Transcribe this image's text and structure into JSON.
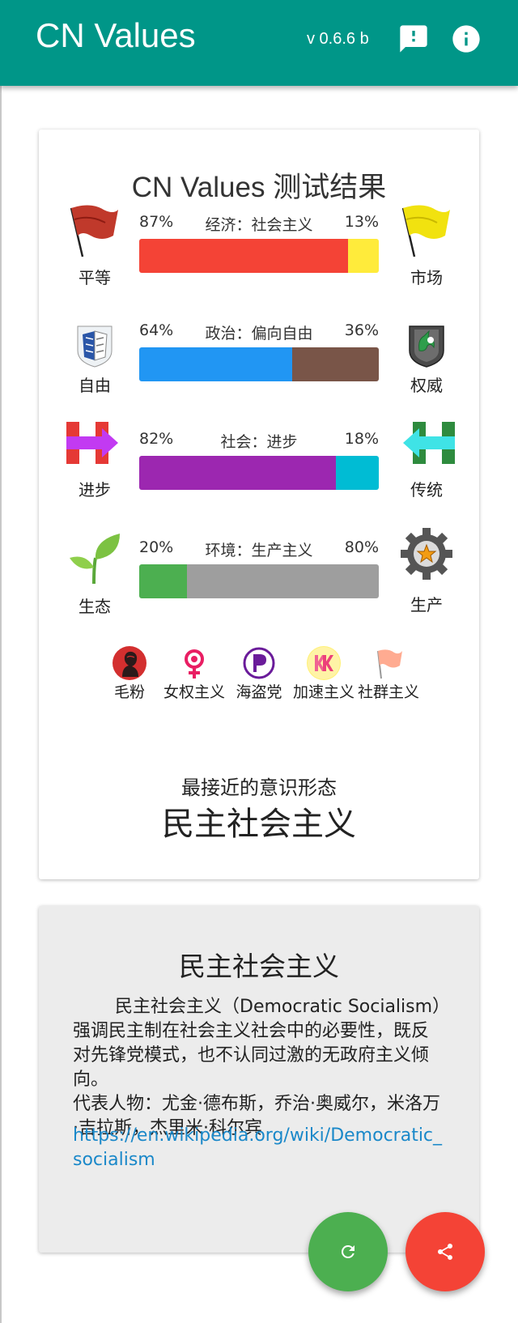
{
  "appbar": {
    "title": "CN Values",
    "version": "v 0.6.6 b",
    "icons": [
      "feedback-icon",
      "info-icon"
    ]
  },
  "result": {
    "title": "CN Values 测试结果",
    "axes": [
      {
        "left_label": "平等",
        "right_label": "市场",
        "left_pct": "87%",
        "right_pct": "13%",
        "name": "经济：社会主义",
        "left_value": 87,
        "left_color": "#f44336",
        "right_color": "#ffeb3b",
        "left_icon": "red-flag-icon",
        "right_icon": "yellow-flag-icon"
      },
      {
        "left_label": "自由",
        "right_label": "权威",
        "left_pct": "64%",
        "right_pct": "36%",
        "name": "政治：偏向自由",
        "left_value": 64,
        "left_color": "#2196f3",
        "right_color": "#795548",
        "left_icon": "wings-emblem-icon",
        "right_icon": "unicorn-shield-icon"
      },
      {
        "left_label": "进步",
        "right_label": "传统",
        "left_pct": "82%",
        "right_pct": "18%",
        "name": "社会：进步",
        "left_value": 82,
        "left_color": "#9c27b0",
        "right_color": "#00bcd4",
        "left_icon": "arrow-right-h-icon",
        "right_icon": "arrow-left-h-icon"
      },
      {
        "left_label": "生态",
        "right_label": "生产",
        "left_pct": "20%",
        "right_pct": "80%",
        "name": "环境：生产主义",
        "left_value": 20,
        "left_color": "#4caf50",
        "right_color": "#9e9e9e",
        "left_icon": "sprout-icon",
        "right_icon": "gear-star-icon"
      }
    ],
    "badges": [
      {
        "label": "毛粉",
        "icon": "mao-portrait-icon"
      },
      {
        "label": "女权主义",
        "icon": "feminism-symbol-icon"
      },
      {
        "label": "海盗党",
        "icon": "pirate-party-icon"
      },
      {
        "label": "加速主义",
        "icon": "kk-accelerationism-icon"
      },
      {
        "label": "社群主义",
        "icon": "orange-flag-icon"
      }
    ],
    "closest_label": "最接近的意识形态",
    "ideology": "民主社会主义"
  },
  "detail": {
    "title": "民主社会主义",
    "body": "民主社会主义（Democratic Socialism）强调民主制在社会主义社会中的必要性，既反对先锋党模式，也不认同过激的无政府主义倾向。",
    "representatives": "代表人物：尤金·德布斯，乔治·奥威尔，米洛万·吉拉斯，杰里米·科尔宾",
    "link": "https://en.wikipedia.org/wiki/Democratic_socialism"
  },
  "fabs": {
    "refresh_color": "#4caf50",
    "share_color": "#f44336"
  }
}
